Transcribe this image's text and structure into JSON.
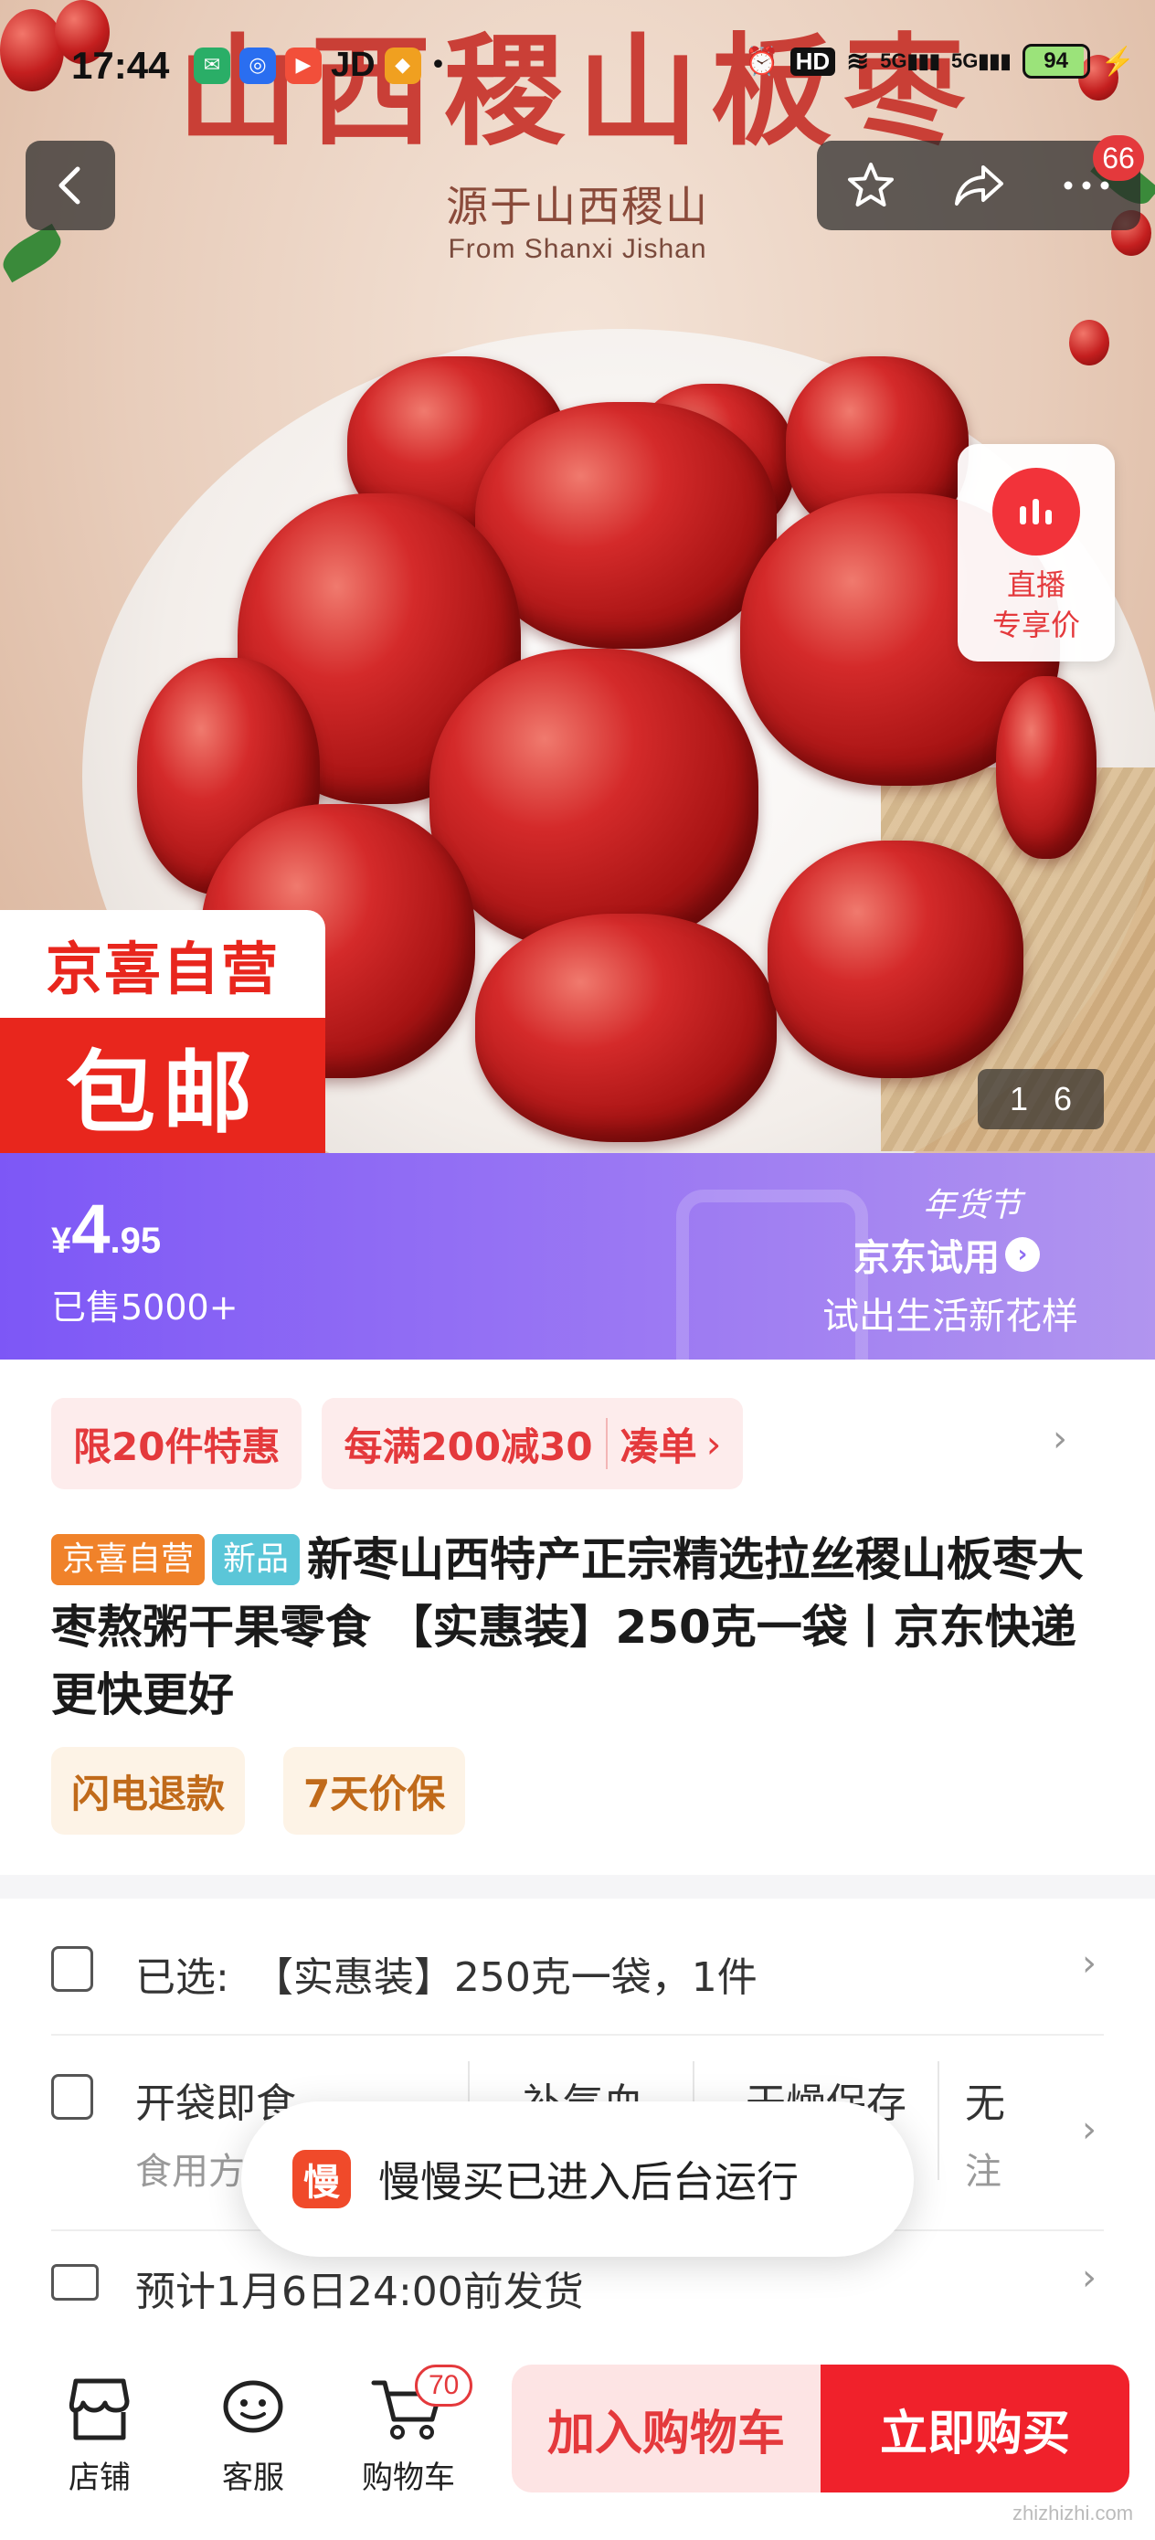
{
  "status_bar": {
    "time": "17:44",
    "app_label": "JD",
    "hd_label": "HD",
    "network": "5G",
    "battery": "94"
  },
  "hero": {
    "title": "山西稷山板枣",
    "subtitle": "源于山西稷山",
    "subtitle_en": "From Shanxi Jishan",
    "notification_count": "66",
    "live_label_1": "直播",
    "live_label_2": "专享价",
    "badge_top": "京喜自营",
    "badge_bottom": "包邮",
    "image_index": "1",
    "image_total": "6"
  },
  "price_banner": {
    "currency": "¥",
    "price_int": "4",
    "price_dec": ".95",
    "sold": "已售5000+",
    "festival": "年货节",
    "trial_title": "京东试用",
    "trial_sub": "试出生活新花样",
    "colors": {
      "start": "#7d57f6",
      "end": "#b195ef"
    }
  },
  "coupons": {
    "limit": "限20件特惠",
    "discount": "每满200减30",
    "combine": "凑单"
  },
  "product": {
    "tag_jx": "京喜自营",
    "tag_new": "新品",
    "title": "新枣山西特产正宗精选拉丝稷山板枣大枣熬粥干果零食 【实惠装】250克一袋丨京东快递 更快更好",
    "services": [
      "闪电退款",
      "7天价保"
    ]
  },
  "specs": {
    "selected_label": "已选:",
    "selected_value": "【实惠装】250克一袋，1件",
    "attrs": [
      {
        "title": "开袋即食",
        "sub": "食用方"
      },
      {
        "title": "补气血",
        "sub": ""
      },
      {
        "title": "干燥保存",
        "sub": ""
      },
      {
        "title": "无",
        "sub": "注"
      }
    ],
    "shipping": "预计1月6日24:00前发货"
  },
  "toast": {
    "icon_char": "慢",
    "text": "慢慢买已进入后台运行"
  },
  "bottom_bar": {
    "shop": "店铺",
    "service": "客服",
    "cart": "购物车",
    "cart_count": "70",
    "add_to_cart": "加入购物车",
    "buy_now": "立即购买"
  },
  "watermark": "zhizhizhi.com",
  "colors": {
    "accent": "#e4393c",
    "buy": "#f0212b"
  }
}
